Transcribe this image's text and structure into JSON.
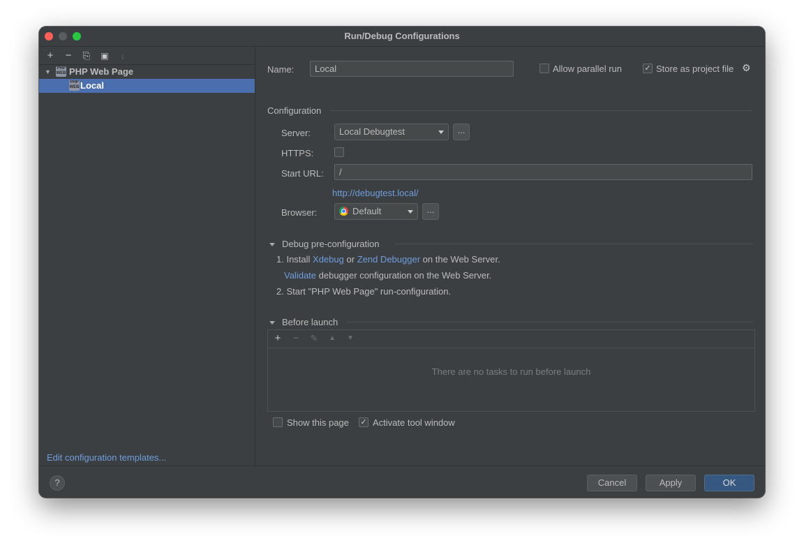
{
  "window": {
    "title": "Run/Debug Configurations"
  },
  "left_toolbar": {
    "add": "+",
    "remove": "−",
    "copy": "⎘",
    "folder": "▣",
    "sort": "↓"
  },
  "tree": {
    "group": {
      "label": "PHP Web Page",
      "icon": "php-icon"
    },
    "items": [
      {
        "label": "Local",
        "icon": "php-icon",
        "selected": true
      }
    ]
  },
  "edit_templates_link": "Edit configuration templates...",
  "config": {
    "name_label": "Name:",
    "name_value": "Local",
    "allow_parallel_label": "Allow parallel run",
    "allow_parallel_checked": false,
    "store_project_label": "Store as project file",
    "store_project_checked": true,
    "configuration_section": "Configuration",
    "server_label": "Server:",
    "server_value": "Local Debugtest",
    "server_more": "...",
    "https_label": "HTTPS:",
    "https_checked": false,
    "start_url_label": "Start URL:",
    "start_url_value": "/",
    "resolved_url": "http://debugtest.local/",
    "browser_label": "Browser:",
    "browser_value": "Default",
    "browser_more": "..."
  },
  "debug_pre": {
    "title": "Debug pre-configuration",
    "step1_prefix": "1. Install",
    "xdebug": "Xdebug",
    "or": "or",
    "zend": "Zend Debugger",
    "step1_suffix": "on the Web Server.",
    "validate": "Validate",
    "validate_suffix": "debugger configuration on the Web Server.",
    "step2": "2. Start \"PHP Web Page\" run-configuration."
  },
  "before_launch": {
    "title": "Before launch",
    "empty_text": "There are no tasks to run before launch",
    "toolbar": {
      "add": "+",
      "remove": "−",
      "edit": "✎",
      "up": "▲",
      "down": "▼"
    }
  },
  "options": {
    "show_page_label": "Show this page",
    "show_page_checked": false,
    "activate_tool_label": "Activate tool window",
    "activate_tool_checked": true
  },
  "footer": {
    "help": "?",
    "cancel": "Cancel",
    "apply": "Apply",
    "ok": "OK"
  },
  "check_mark": "✓",
  "colors": {
    "selection": "#4b6eaf",
    "link": "#6f9dde",
    "primary_button": "#365880"
  }
}
